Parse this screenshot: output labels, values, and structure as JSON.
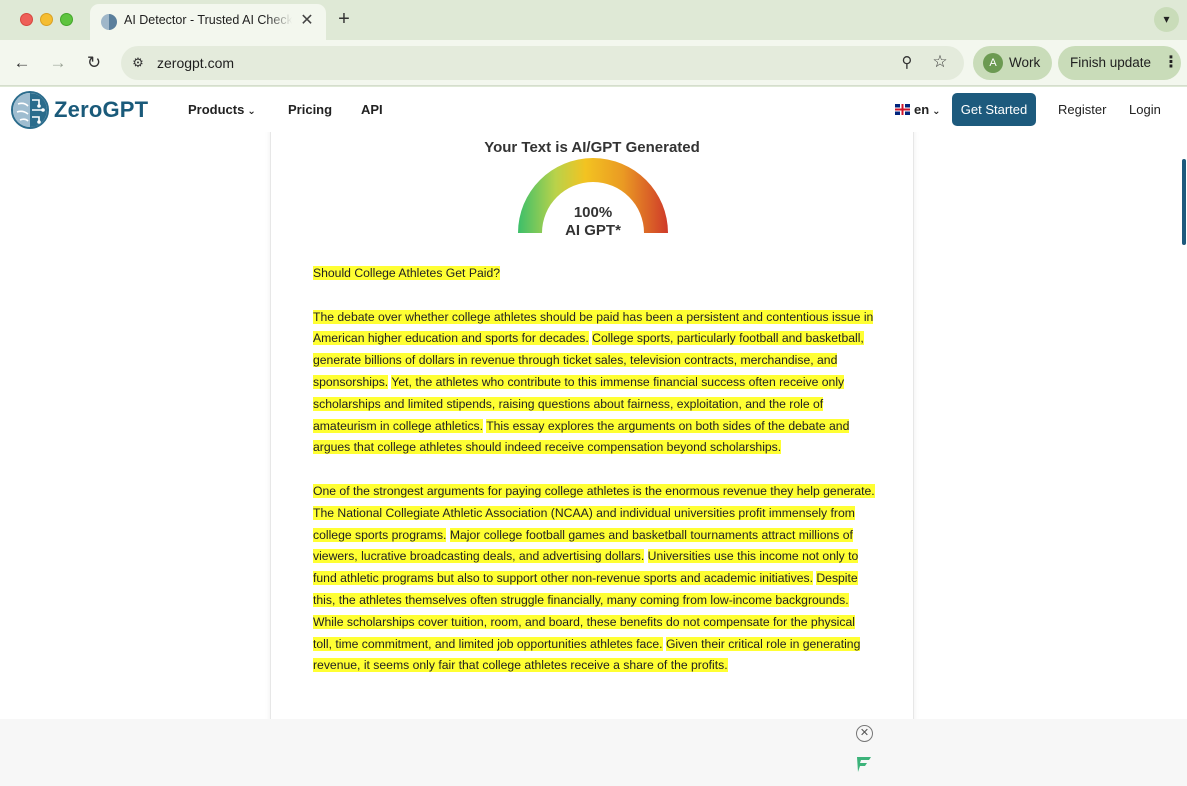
{
  "browser": {
    "tab_title": "AI Detector - Trusted AI Checker",
    "tab_close": "✕",
    "new_tab": "+",
    "url": "zerogpt.com",
    "profile_initial": "A",
    "profile_label": "Work",
    "update_label": "Finish update",
    "colors": {
      "frame": "#dfe9d6",
      "toolbar": "#f3f7ee",
      "pill": "#c9dcb9"
    }
  },
  "site": {
    "logo_text": "ZeroGPT",
    "menu": {
      "products": "Products",
      "pricing": "Pricing",
      "api": "API"
    },
    "language": "en",
    "get_started": "Get Started",
    "register": "Register",
    "login": "Login",
    "accent_color": "#1d5a7d"
  },
  "result": {
    "title": "Your Text is AI/GPT Generated",
    "gauge_value": "100%",
    "gauge_label": "AI GPT*",
    "ai_fraction": 1.0
  },
  "essay": {
    "highlight_color": "#ffff33",
    "paragraphs": [
      [
        "Should College Athletes Get Paid?"
      ],
      [
        "The debate over whether college athletes should be paid has been a persistent and contentious issue in American higher education and sports for decades.",
        "College sports, particularly football and basketball, generate billions of dollars in revenue through ticket sales, television contracts, merchandise, and sponsorships.",
        "Yet, the athletes who contribute to this immense financial success often receive only scholarships and limited stipends, raising questions about fairness, exploitation, and the role of amateurism in college athletics.",
        "This essay explores the arguments on both sides of the debate and argues that college athletes should indeed receive compensation beyond scholarships."
      ],
      [
        "One of the strongest arguments for paying college athletes is the enormous revenue they help generate.",
        "The National Collegiate Athletic Association (NCAA) and individual universities profit immensely from college sports programs.",
        "Major college football games and basketball tournaments attract millions of viewers, lucrative broadcasting deals, and advertising dollars.",
        "Universities use this income not only to fund athletic programs but also to support other non-revenue sports and academic initiatives.",
        "Despite this, the athletes themselves often struggle financially, many coming from low-income backgrounds.",
        "While scholarships cover tuition, room, and board, these benefits do not compensate for the physical toll, time commitment, and limited job opportunities athletes face.",
        "Given their critical role in generating revenue, it seems only fair that college athletes receive a share of the profits."
      ]
    ]
  },
  "icons": {
    "back": "back-arrow-icon",
    "forward": "forward-arrow-icon",
    "reload": "reload-icon",
    "site_info": "tune-icon",
    "zoom": "zoom-icon",
    "bookmark": "star-icon",
    "tab_search": "chevron-down-icon",
    "ad_close": "close-circle-icon",
    "ad_logo": "freestar-icon"
  }
}
